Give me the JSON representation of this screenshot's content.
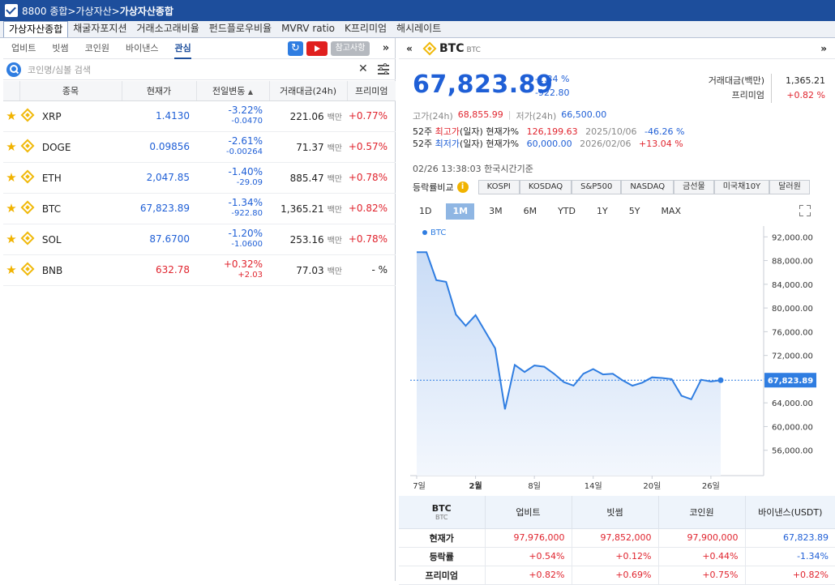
{
  "window": {
    "code": "8800 종합>가상자산>",
    "title": "가상자산종합"
  },
  "menu": [
    "가상자산종합",
    "채굴자포지션",
    "거래소고래비율",
    "펀드플로우비율",
    "MVRV ratio",
    "K프리미엄",
    "해시레이트"
  ],
  "left": {
    "tabs": [
      "업비트",
      "빗썸",
      "코인원",
      "바이낸스",
      "관심"
    ],
    "ref_label": "참고사항",
    "search_placeholder": "코인명/심볼 검색",
    "headers": [
      "종목",
      "현재가",
      "전일변동",
      "거래대금(24h)",
      "프리미엄"
    ],
    "sort_icon": "▲",
    "unit": "백만",
    "rows": [
      {
        "sym": "XRP",
        "price": "1.4130",
        "price_color": "blue",
        "chg": "-3.22%",
        "chg_abs": "-0.0470",
        "chg_color": "blue",
        "vol": "221.06",
        "prem": "+0.77%",
        "prem_color": "red"
      },
      {
        "sym": "DOGE",
        "price": "0.09856",
        "price_color": "blue",
        "chg": "-2.61%",
        "chg_abs": "-0.00264",
        "chg_color": "blue",
        "vol": "71.37",
        "prem": "+0.57%",
        "prem_color": "red"
      },
      {
        "sym": "ETH",
        "price": "2,047.85",
        "price_color": "blue",
        "chg": "-1.40%",
        "chg_abs": "-29.09",
        "chg_color": "blue",
        "vol": "885.47",
        "prem": "+0.78%",
        "prem_color": "red"
      },
      {
        "sym": "BTC",
        "price": "67,823.89",
        "price_color": "blue",
        "chg": "-1.34%",
        "chg_abs": "-922.80",
        "chg_color": "blue",
        "vol": "1,365.21",
        "prem": "+0.82%",
        "prem_color": "red"
      },
      {
        "sym": "SOL",
        "price": "87.6700",
        "price_color": "blue",
        "chg": "-1.20%",
        "chg_abs": "-1.0600",
        "chg_color": "blue",
        "vol": "253.16",
        "prem": "+0.78%",
        "prem_color": "red"
      },
      {
        "sym": "BNB",
        "price": "632.78",
        "price_color": "red",
        "chg": "+0.32%",
        "chg_abs": "+2.03",
        "chg_color": "red",
        "vol": "77.03",
        "prem": "- %",
        "prem_color": "dark"
      }
    ]
  },
  "right": {
    "name": "BTC",
    "sub": "BTC",
    "price": "67,823.89",
    "chg_pct": "-1.34 %",
    "chg_abs": "-922.80",
    "vol_label": "거래대금(백만)",
    "vol_value": "1,365.21",
    "prem_label": "프리미엄",
    "prem_value": "+0.82 %",
    "high_label": "고가(24h)",
    "high_value": "68,855.99",
    "low_label": "저가(24h)",
    "low_value": "66,500.00",
    "w52_high": {
      "pre": "52주 ",
      "key": "최고가",
      "post": "(일자) 현재가%",
      "price": "126,199.63",
      "date": "2025/10/06",
      "pct": "-46.26 %"
    },
    "w52_low": {
      "pre": "52주 ",
      "key": "최저가",
      "post": "(일자) 현재가%",
      "price": "60,000.00",
      "date": "2026/02/06",
      "pct": "+13.04 %"
    },
    "timestamp": "02/26 13:38:03  한국시간기준",
    "compare_label": "등락률비교",
    "compare_items": [
      "KOSPI",
      "KOSDAQ",
      "S&P500",
      "NASDAQ",
      "금선물",
      "미국채10Y",
      "달러원"
    ],
    "ranges": [
      "1D",
      "1M",
      "3M",
      "6M",
      "YTD",
      "1Y",
      "5Y",
      "MAX"
    ],
    "active_range": "1M"
  },
  "chart_data": {
    "type": "area",
    "legend": "BTC",
    "ylim": [
      52000,
      93000
    ],
    "y_ticks": [
      "92,000.00",
      "88,000.00",
      "84,000.00",
      "80,000.00",
      "76,000.00",
      "72,000.00",
      "68,000.00",
      "64,000.00",
      "60,000.00",
      "56,000.00"
    ],
    "x_ticks": [
      "7일",
      "2월",
      "8일",
      "14일",
      "20일",
      "26일"
    ],
    "current_label": "67,823.89",
    "current_value": 67823.89,
    "values": [
      89400,
      89400,
      84700,
      84400,
      78900,
      77000,
      78800,
      76000,
      73200,
      62900,
      70400,
      69200,
      70300,
      70100,
      68900,
      67500,
      66900,
      68900,
      69700,
      68800,
      68900,
      67800,
      66900,
      67400,
      68300,
      68200,
      68000,
      65200,
      64600,
      67900,
      67600,
      67823.89
    ],
    "colors": {
      "line": "#2f7de1",
      "fill": "#dce9fb",
      "current_line": "#2f7de1"
    }
  },
  "exchange_table": {
    "corner": "BTC",
    "corner_sub": "BTC",
    "headers": [
      "업비트",
      "빗썸",
      "코인원",
      "바이낸스(USDT)"
    ],
    "rows": [
      {
        "label": "현재가",
        "cells": [
          [
            "97,976,000",
            "red"
          ],
          [
            "97,852,000",
            "red"
          ],
          [
            "97,900,000",
            "red"
          ],
          [
            "67,823.89",
            "blue"
          ]
        ]
      },
      {
        "label": "등락률",
        "cells": [
          [
            "+0.54%",
            "red"
          ],
          [
            "+0.12%",
            "red"
          ],
          [
            "+0.44%",
            "red"
          ],
          [
            "-1.34%",
            "blue"
          ]
        ]
      },
      {
        "label": "프리미엄",
        "cells": [
          [
            "+0.82%",
            "red"
          ],
          [
            "+0.69%",
            "red"
          ],
          [
            "+0.75%",
            "red"
          ],
          [
            "+0.82%",
            "red"
          ]
        ]
      }
    ]
  }
}
